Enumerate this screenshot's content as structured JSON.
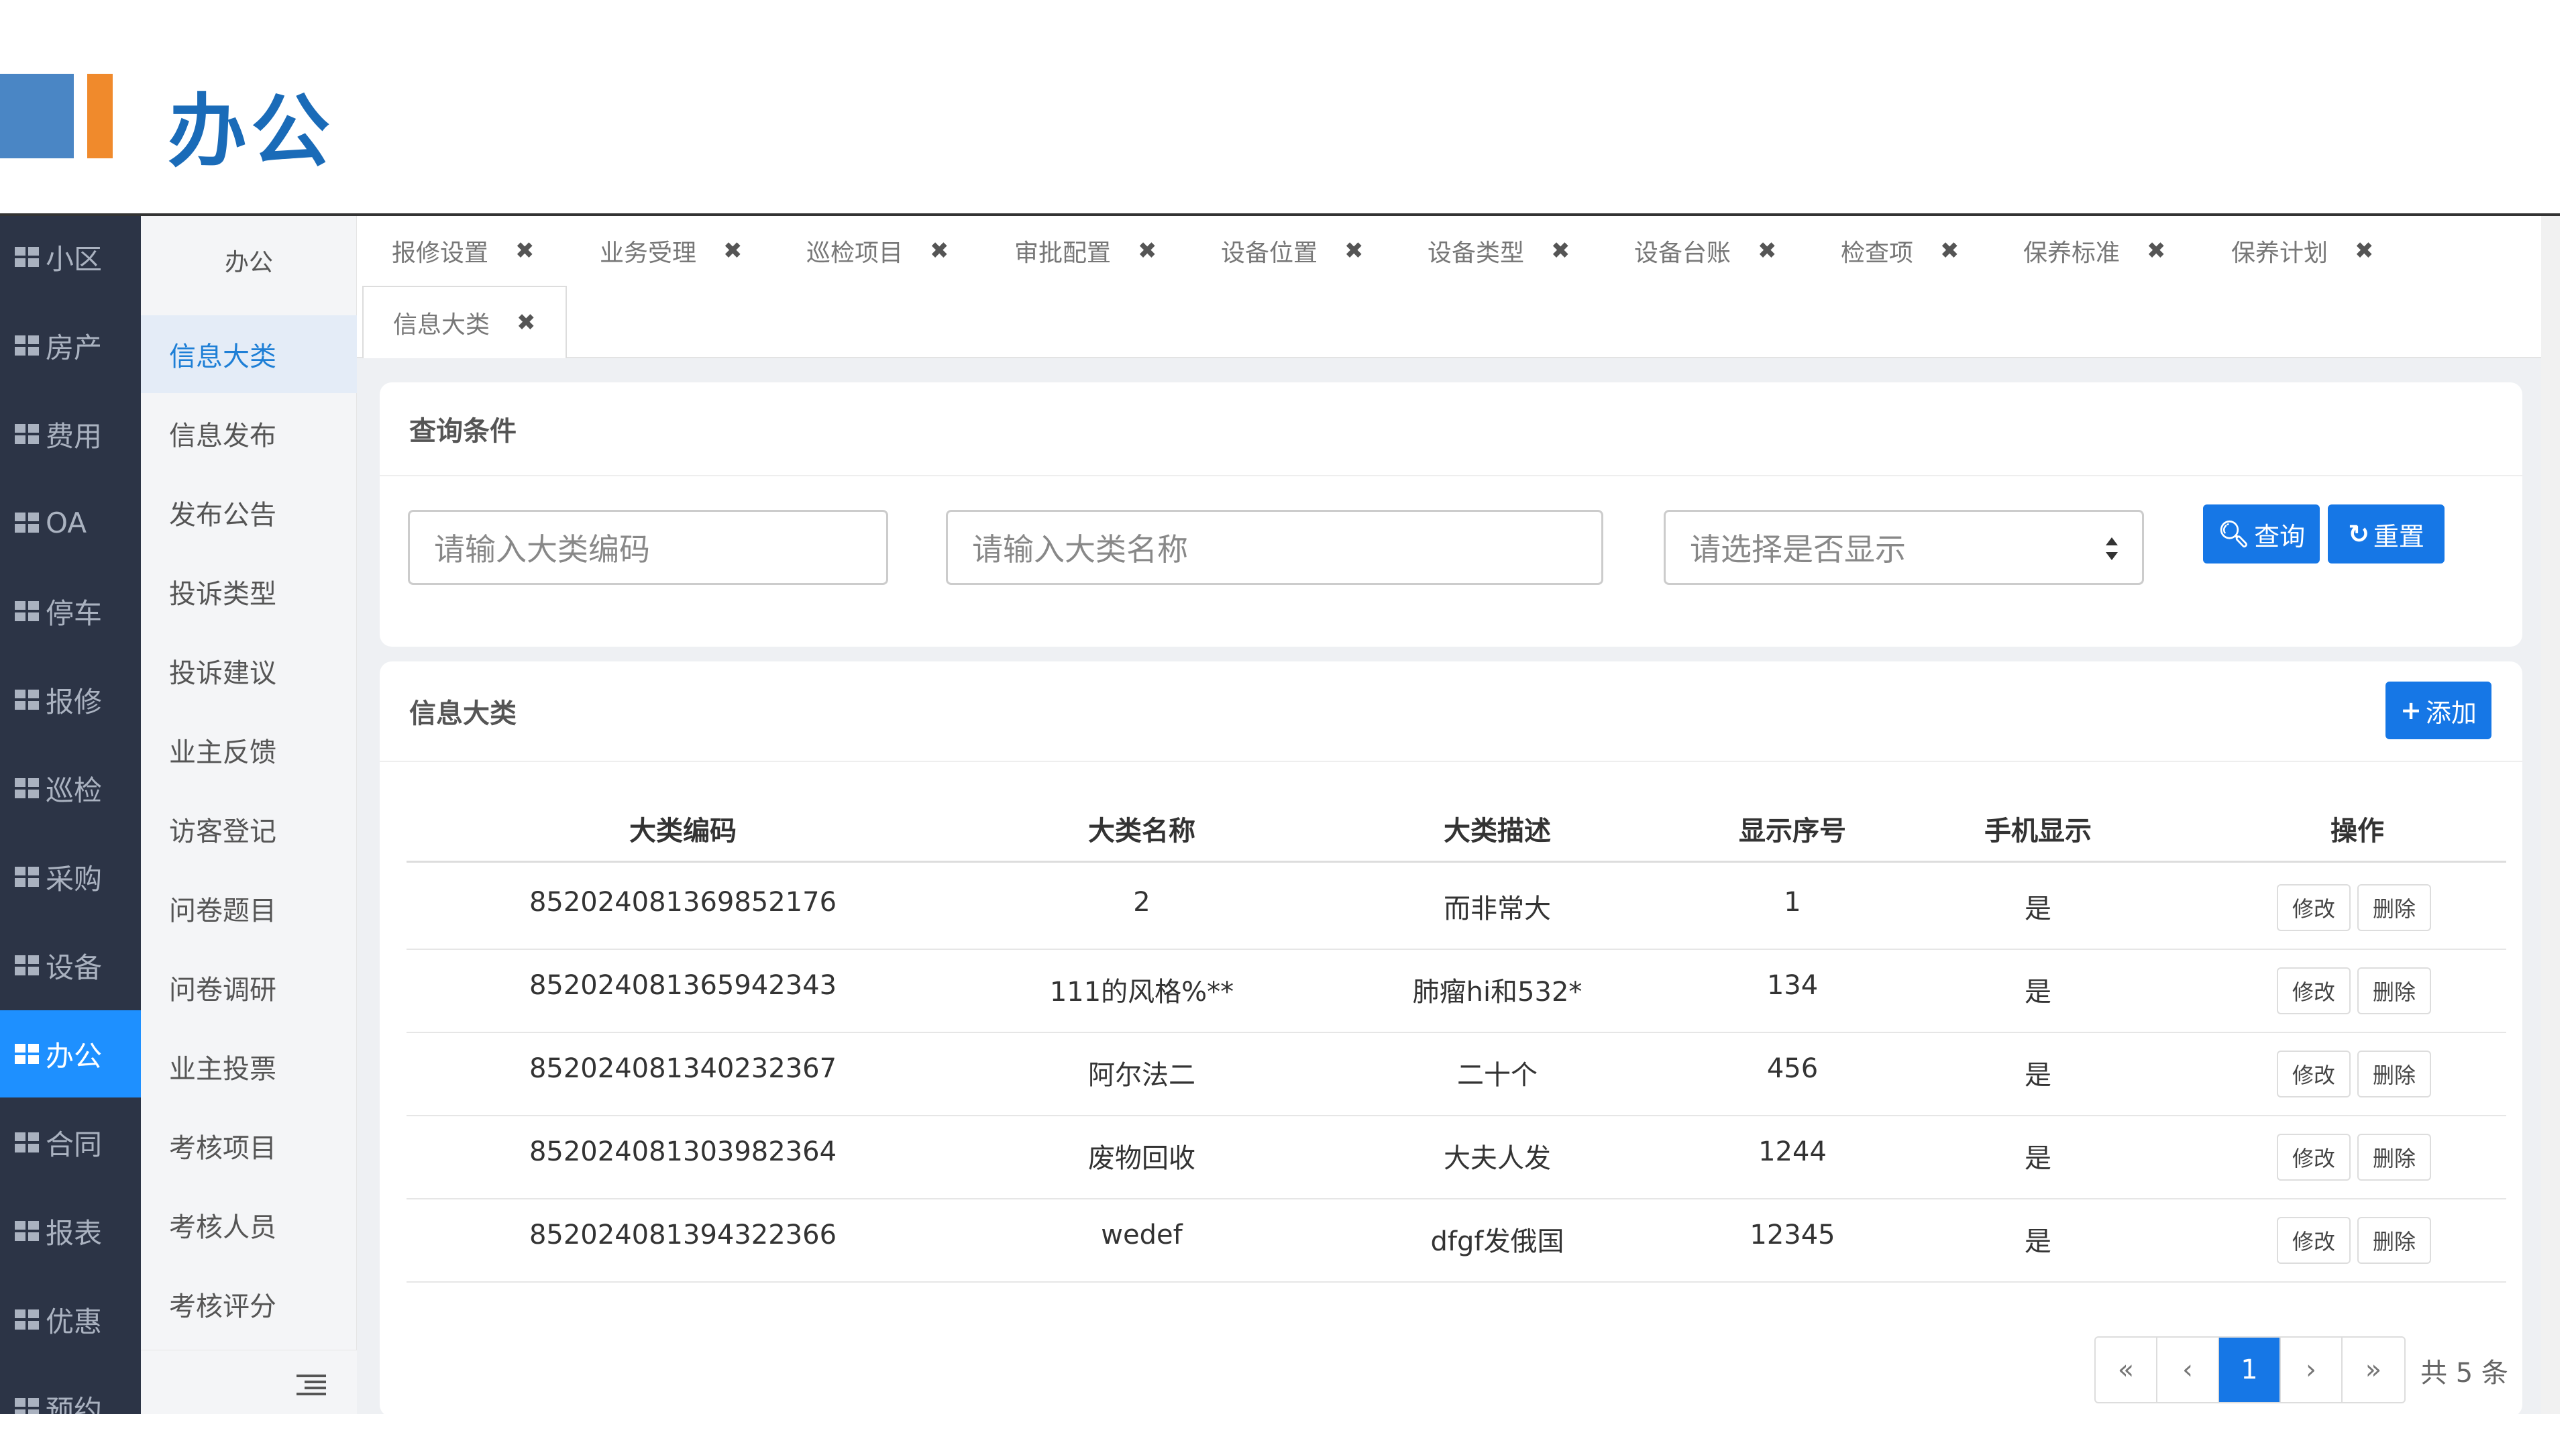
{
  "slide": {
    "title": "办公"
  },
  "nav": {
    "items": [
      {
        "label": "小区"
      },
      {
        "label": "房产"
      },
      {
        "label": "费用"
      },
      {
        "label": "OA"
      },
      {
        "label": "停车"
      },
      {
        "label": "报修"
      },
      {
        "label": "巡检"
      },
      {
        "label": "采购"
      },
      {
        "label": "设备"
      },
      {
        "label": "办公"
      },
      {
        "label": "合同"
      },
      {
        "label": "报表"
      },
      {
        "label": "优惠"
      },
      {
        "label": "预约"
      }
    ],
    "active_index": 9
  },
  "submenu": {
    "title": "办公",
    "items": [
      {
        "label": "信息大类"
      },
      {
        "label": "信息发布"
      },
      {
        "label": "发布公告"
      },
      {
        "label": "投诉类型"
      },
      {
        "label": "投诉建议"
      },
      {
        "label": "业主反馈"
      },
      {
        "label": "访客登记"
      },
      {
        "label": "问卷题目"
      },
      {
        "label": "问卷调研"
      },
      {
        "label": "业主投票"
      },
      {
        "label": "考核项目"
      },
      {
        "label": "考核人员"
      },
      {
        "label": "考核评分"
      }
    ]
  },
  "tabs": [
    {
      "label": "报修设置"
    },
    {
      "label": "业务受理"
    },
    {
      "label": "巡检项目"
    },
    {
      "label": "审批配置"
    },
    {
      "label": "设备位置"
    },
    {
      "label": "设备类型"
    },
    {
      "label": "设备台账"
    },
    {
      "label": "检查项"
    },
    {
      "label": "保养标准"
    },
    {
      "label": "保养计划"
    },
    {
      "label": "信息大类"
    }
  ],
  "tab_close": "✖",
  "query": {
    "title": "查询条件",
    "code_placeholder": "请输入大类编码",
    "name_placeholder": "请输入大类名称",
    "display_select": "请选择是否显示",
    "search_label": "查询",
    "reset_label": "重置"
  },
  "list": {
    "title": "信息大类",
    "add_label": "添加",
    "columns": [
      "大类编码",
      "大类名称",
      "大类描述",
      "显示序号",
      "手机显示",
      "操作"
    ],
    "rows": [
      [
        "852024081369852176",
        "2",
        "而非常大",
        "1",
        "是"
      ],
      [
        "852024081365942343",
        "111的风格%**",
        "肺瘤hi和532*",
        "134",
        "是"
      ],
      [
        "852024081340232367",
        "阿尔法二",
        "二十个",
        "456",
        "是"
      ],
      [
        "852024081303982364",
        "废物回收",
        "大夫人发",
        "1244",
        "是"
      ],
      [
        "852024081394322366",
        "wedef",
        "dfgf发俄国",
        "12345",
        "是"
      ]
    ],
    "edit_label": "修改",
    "delete_label": "删除"
  },
  "pagination": {
    "first": "«",
    "prev": "‹",
    "current": "1",
    "next": "›",
    "last": "»",
    "total": "共 5 条"
  },
  "colors": {
    "primary": "#1677e6",
    "nav_bg": "#2c3446",
    "title": "#1a6bb8",
    "accent": "#f08a2c"
  }
}
